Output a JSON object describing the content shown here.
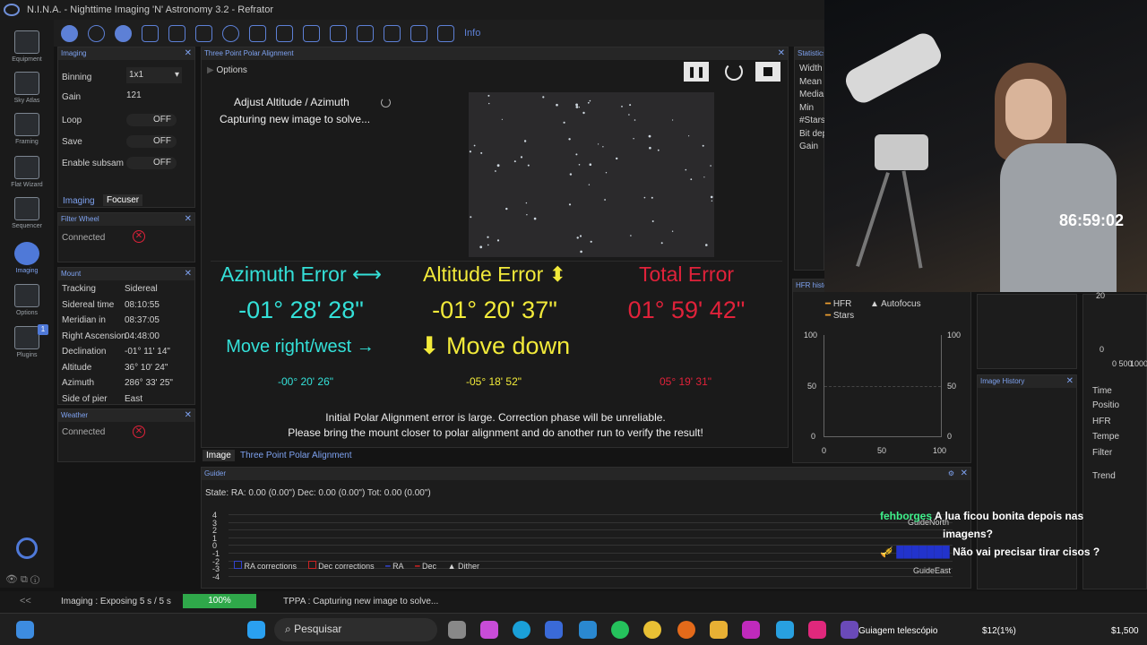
{
  "window": {
    "title": "N.I.N.A. - Nighttime Imaging 'N' Astronomy 3.2  -  Refrator"
  },
  "nav": [
    {
      "label": "Equipment"
    },
    {
      "label": "Sky Atlas"
    },
    {
      "label": "Framing"
    },
    {
      "label": "Flat Wizard"
    },
    {
      "label": "Sequencer"
    },
    {
      "label": "Imaging"
    },
    {
      "label": "Options"
    },
    {
      "label": "Plugins",
      "badge": "1"
    }
  ],
  "toolbar": {
    "info_label": "Info"
  },
  "imaging": {
    "title": "Imaging",
    "rows": [
      {
        "label": "Binning",
        "value": "1x1"
      },
      {
        "label": "Gain",
        "value": "121"
      },
      {
        "label": "Loop",
        "value": "OFF"
      },
      {
        "label": "Save",
        "value": "OFF"
      },
      {
        "label": "Enable subsam",
        "value": "OFF"
      }
    ],
    "tabs": [
      "Imaging",
      "Focuser"
    ]
  },
  "filterwheel": {
    "title": "Filter Wheel",
    "status": "Connected"
  },
  "mount": {
    "title": "Mount",
    "rows": [
      {
        "label": "Tracking",
        "value": "Sidereal"
      },
      {
        "label": "Sidereal time",
        "value": "08:10:55"
      },
      {
        "label": "Meridian in",
        "value": "08:37:05"
      },
      {
        "label": "Right Ascension",
        "value": "04:48:00"
      },
      {
        "label": "Declination",
        "value": "-01° 11' 14\""
      },
      {
        "label": "Altitude",
        "value": "36° 10' 24\""
      },
      {
        "label": "Azimuth",
        "value": "286° 33' 25\""
      },
      {
        "label": "Side of pier",
        "value": "East"
      }
    ]
  },
  "weather": {
    "title": "Weather",
    "status": "Connected"
  },
  "tppa": {
    "title": "Three Point Polar Alignment",
    "options_label": "Options",
    "step": "Adjust Altitude / Azimuth",
    "status": "Capturing new image to solve...",
    "azimuth": {
      "label": "Azimuth Error ⟷",
      "value": "-01° 28' 28\"",
      "hint": "Move right/west →",
      "small": "-00° 20' 26\""
    },
    "altitude": {
      "label": "Altitude Error ⬍",
      "value": "-01° 20' 37\"",
      "hint": "⬇ Move down",
      "small": "-05° 18' 52\""
    },
    "total": {
      "label": "Total Error",
      "value": "01° 59' 42\"",
      "small": "05° 19' 31\""
    },
    "warning1": "Initial Polar Alignment error is large. Correction phase will be unreliable.",
    "warning2": "Please bring the mount closer to polar alignment and do another run to verify the result!",
    "tabs": [
      "Image",
      "Three Point Polar Alignment"
    ]
  },
  "statistics": {
    "title": "Statistics",
    "rows": [
      "Width",
      "Mean",
      "Media",
      "Min",
      "#Stars",
      "Bit dep",
      "Gain"
    ]
  },
  "hfr": {
    "title": "HFR histo",
    "legend": [
      "HFR",
      "Autofocus",
      "Stars"
    ],
    "yticks": [
      "100",
      "50",
      "0"
    ],
    "xticks": [
      "0",
      "50",
      "100"
    ]
  },
  "imagehistory": {
    "title": "Image History"
  },
  "rightlist": [
    "Time",
    "Positio",
    "HFR",
    "Tempe",
    "Filter",
    "Trend"
  ],
  "rightticks": [
    "20",
    "0",
    "0 500",
    "1000"
  ],
  "guider": {
    "title": "Guider",
    "state": "State:  RA: 0.00 (0.00\")  Dec: 0.00 (0.00\")  Tot: 0.00 (0.00\")",
    "yticks": [
      "4",
      "3",
      "2",
      "1",
      "0",
      "-1",
      "-2",
      "-3",
      "-4"
    ],
    "legend": [
      "RA corrections",
      "Dec corrections",
      "RA",
      "Dec",
      "Dither"
    ],
    "north": "GuideNorth",
    "east": "GuideEast"
  },
  "statusbar": {
    "imaging": "Imaging :   Exposing 5 s / 5 s",
    "progress": "100%",
    "progress_value": 1.0,
    "tppa": "TPPA :   Capturing new image to solve..."
  },
  "overlay": {
    "timer": "86:59:02",
    "chat": [
      {
        "user": "fehborges",
        "msg": "A lua ficou bonita depois nas"
      },
      {
        "user": "",
        "msg": "imagens?"
      },
      {
        "user": "",
        "msg": "Não vai precisar tirar cisos ?"
      }
    ]
  },
  "taskbar": {
    "search": "Pesquisar",
    "items": [
      "Guiagem telescópio",
      "$12(1%)",
      "$1,500"
    ]
  },
  "colors": {
    "accent": "#4f79d8",
    "cyan": "#34e0d8",
    "yellow": "#f2ea3a",
    "red": "#e0223a"
  }
}
